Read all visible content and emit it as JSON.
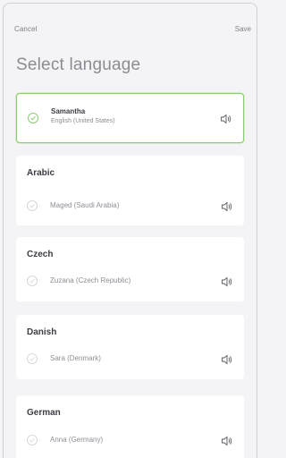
{
  "header": {
    "cancel_label": "Cancel",
    "save_label": "Save",
    "title": "Select language"
  },
  "colors": {
    "accent_green": "#8ccc73",
    "card_bg": "#ffffff",
    "page_bg": "#f4f4f6"
  },
  "selected_voice": {
    "name": "Samantha",
    "subtitle": "English (United States)"
  },
  "languages": [
    {
      "language": "Arabic",
      "voice": "Maged (Saudi Arabia)"
    },
    {
      "language": "Czech",
      "voice": "Zuzana (Czech Republic)"
    },
    {
      "language": "Danish",
      "voice": "Sara (Denmark)"
    },
    {
      "language": "German",
      "voice": "Anna (Germany)"
    }
  ],
  "icons": {
    "check": "check-circle-icon",
    "speaker": "speaker-icon"
  }
}
